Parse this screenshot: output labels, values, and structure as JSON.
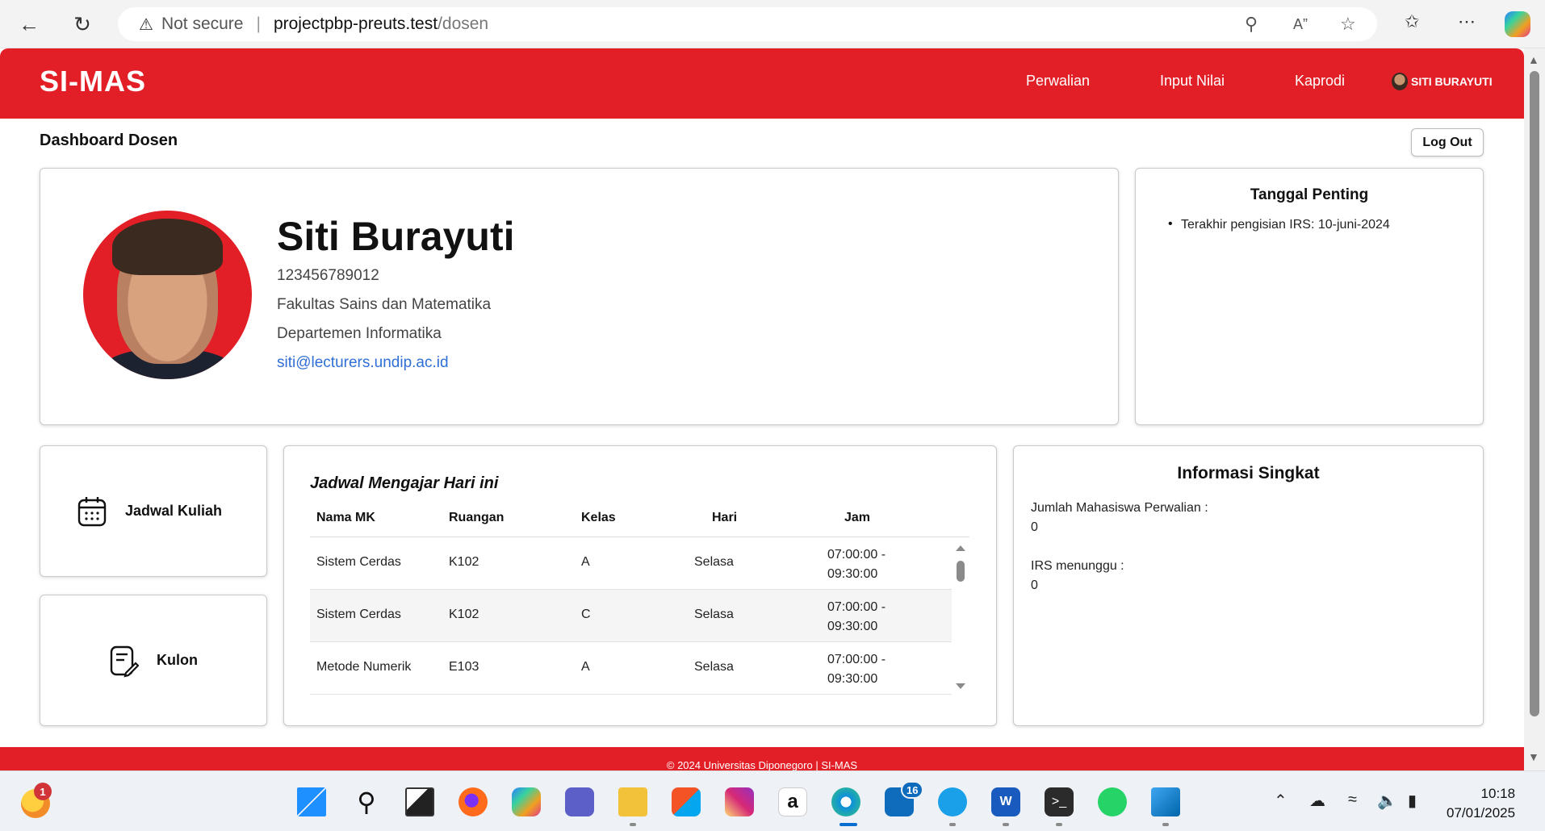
{
  "browser": {
    "security_label": "Not secure",
    "url_host": "projectpbp-preuts.test",
    "url_path": "/dosen"
  },
  "nav": {
    "brand": "SI-MAS",
    "links": [
      "Perwalian",
      "Input Nilai",
      "Kaprodi"
    ],
    "user": "SITI BURAYUTI"
  },
  "page": {
    "title": "Dashboard Dosen",
    "logout": "Log Out"
  },
  "profile": {
    "name": "Siti Burayuti",
    "nip": "123456789012",
    "faculty": "Fakultas Sains dan Matematika",
    "department": "Departemen Informatika",
    "email": "siti@lecturers.undip.ac.id"
  },
  "tanggal_penting": {
    "title": "Tanggal Penting",
    "items": [
      "Terakhir pengisian IRS: 10-juni-2024"
    ]
  },
  "menu": {
    "jadwal": "Jadwal Kuliah",
    "kulon": "Kulon"
  },
  "jadwal": {
    "title": "Jadwal Mengajar Hari ini",
    "headers": [
      "Nama MK",
      "Ruangan",
      "Kelas",
      "Hari",
      "Jam"
    ],
    "rows": [
      {
        "mk": "Sistem Cerdas",
        "ruang": "K102",
        "kelas": "A",
        "hari": "Selasa",
        "jam1": "07:00:00 -",
        "jam2": "09:30:00"
      },
      {
        "mk": "Sistem Cerdas",
        "ruang": "K102",
        "kelas": "C",
        "hari": "Selasa",
        "jam1": "07:00:00 -",
        "jam2": "09:30:00"
      },
      {
        "mk": "Metode Numerik",
        "ruang": "E103",
        "kelas": "A",
        "hari": "Selasa",
        "jam1": "07:00:00 -",
        "jam2": "09:30:00"
      }
    ]
  },
  "info": {
    "title": "Informasi Singkat",
    "perwalian_label": "Jumlah Mahasiswa Perwalian :",
    "perwalian_value": "0",
    "irs_label": "IRS menunggu :",
    "irs_value": "0"
  },
  "footer": "© 2024 Universitas Diponegoro | SI-MAS",
  "taskbar": {
    "weather_badge": "1",
    "outlook_badge": "16",
    "time": "10:18",
    "date": "07/01/2025"
  },
  "colors": {
    "brand_red": "#e21f26",
    "link_blue": "#2f6fd6"
  }
}
